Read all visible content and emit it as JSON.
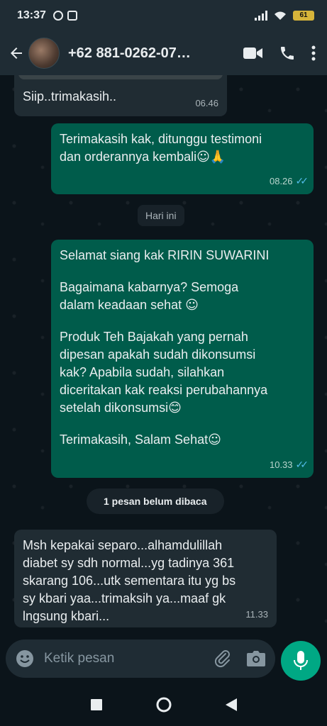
{
  "status_bar": {
    "time": "13:37",
    "battery": "61"
  },
  "header": {
    "contact": "+62 881-0262-07…"
  },
  "messages": [
    {
      "type": "incoming",
      "text": "Siip..trimakasih..",
      "time": "06.46"
    },
    {
      "type": "outgoing",
      "lines": [
        "Terimakasih kak, ditunggu testimoni",
        "dan orderannya kembali"
      ],
      "emoji": "☺🙏",
      "time": "08.26"
    },
    {
      "type": "outgoing",
      "p1": "Selamat siang kak RIRIN SUWARINI",
      "p2": [
        "Bagaimana kabarnya? Semoga",
        "dalam keadaan sehat"
      ],
      "p2_emoji": "☺",
      "p3": [
        "Produk Teh Bajakah yang pernah",
        "dipesan apakah sudah dikonsumsi",
        "kak?  Apabila sudah, silahkan",
        "diceritakan kak reaksi perubahannya",
        "setelah dikonsumsi"
      ],
      "p3_emoji": "😊",
      "p4": "Terimakasih, Salam Sehat",
      "p4_emoji": "☺",
      "time": "10.33"
    },
    {
      "type": "incoming",
      "lines": [
        "Msh kepakai separo...alhamdulillah",
        "diabet sy sdh normal...yg tadinya 361",
        "skarang 106...utk sementara itu yg bs",
        "sy kbari yaa...trimaksih ya...maaf gk",
        "lngsung kbari..."
      ],
      "time": "11.33"
    }
  ],
  "date_chip": "Hari ini",
  "unread_banner": "1 pesan belum dibaca",
  "input": {
    "placeholder": "Ketik pesan"
  },
  "colors": {
    "outgoing": "#005c4b",
    "incoming": "#202c33",
    "accent": "#00a884",
    "tick_read": "#53bdeb"
  },
  "icons": [
    "back-arrow-icon",
    "video-call-icon",
    "phone-icon",
    "more-vert-icon",
    "emoji-icon",
    "attach-icon",
    "camera-icon",
    "mic-icon",
    "nav-square-icon",
    "nav-circle-icon",
    "nav-back-icon"
  ]
}
